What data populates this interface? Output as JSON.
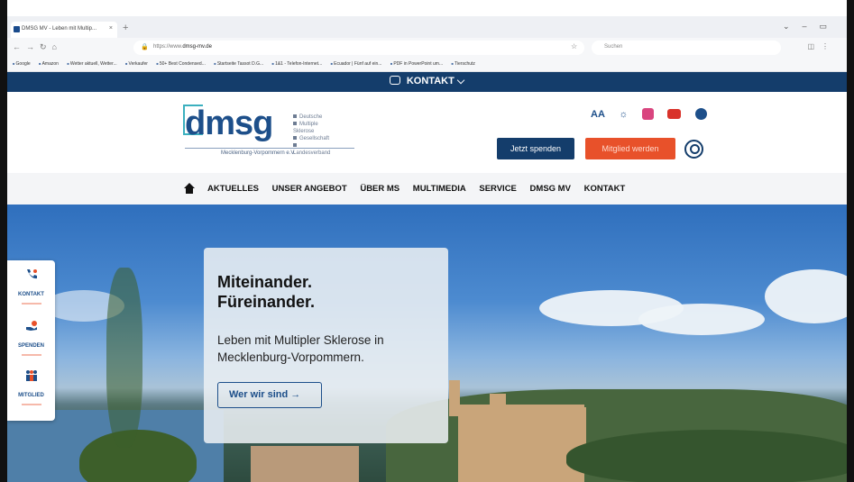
{
  "browser": {
    "tab_title": "DMSG MV - Leben mit Multip...",
    "tab_close": "×",
    "new_tab": "+",
    "url_host": "dmsg-mv.de",
    "url_prefix": "https://www.",
    "search_placeholder": "Suchen",
    "bookmarks": [
      "Google",
      "Amazon",
      "Wetter aktuell, Wetter...",
      "Verkaufer",
      "50+ Best Condensed...",
      "Startseite Tassot D.G...",
      "1&1 - Telefon-Internet...",
      "Ecuador | Fünf auf ein...",
      "PDF in PowerPoint um...",
      "Tierschutz"
    ]
  },
  "topbar": {
    "label": "KONTAKT",
    "chevron": "⌵"
  },
  "logo": {
    "wordmark": "dmsg",
    "lines": [
      "Deutsche",
      "Multiple Sklerose",
      "Gesellschaft",
      "Landesverband"
    ],
    "subtitle": "Mecklenburg-Vorpommern e.V."
  },
  "social": {
    "font_size": "AA",
    "contrast": "☼"
  },
  "buttons": {
    "spenden": "Jetzt spenden",
    "mitglied": "Mitglied werden"
  },
  "nav": {
    "items": [
      "AKTUELLES",
      "UNSER ANGEBOT",
      "ÜBER MS",
      "MULTIMEDIA",
      "SERVICE",
      "DMSG MV",
      "KONTAKT"
    ]
  },
  "sidebar": {
    "items": [
      {
        "label": "KONTAKT",
        "icon": "phone-icon"
      },
      {
        "label": "SPENDEN",
        "icon": "donate-hand-icon"
      },
      {
        "label": "MITGLIED",
        "icon": "people-icon"
      }
    ]
  },
  "hero": {
    "title_line1": "Miteinander.",
    "title_line2": "Füreinander.",
    "subtitle": "Leben mit Multipler Sklerose in Mecklenburg-Vorpommern.",
    "cta": "Wer wir sind",
    "cta_arrow": "→"
  },
  "colors": {
    "navy": "#143d6b",
    "accent_orange": "#e8512a",
    "logo_teal": "#3bb0bf",
    "logo_blue": "#1d4f8a"
  }
}
